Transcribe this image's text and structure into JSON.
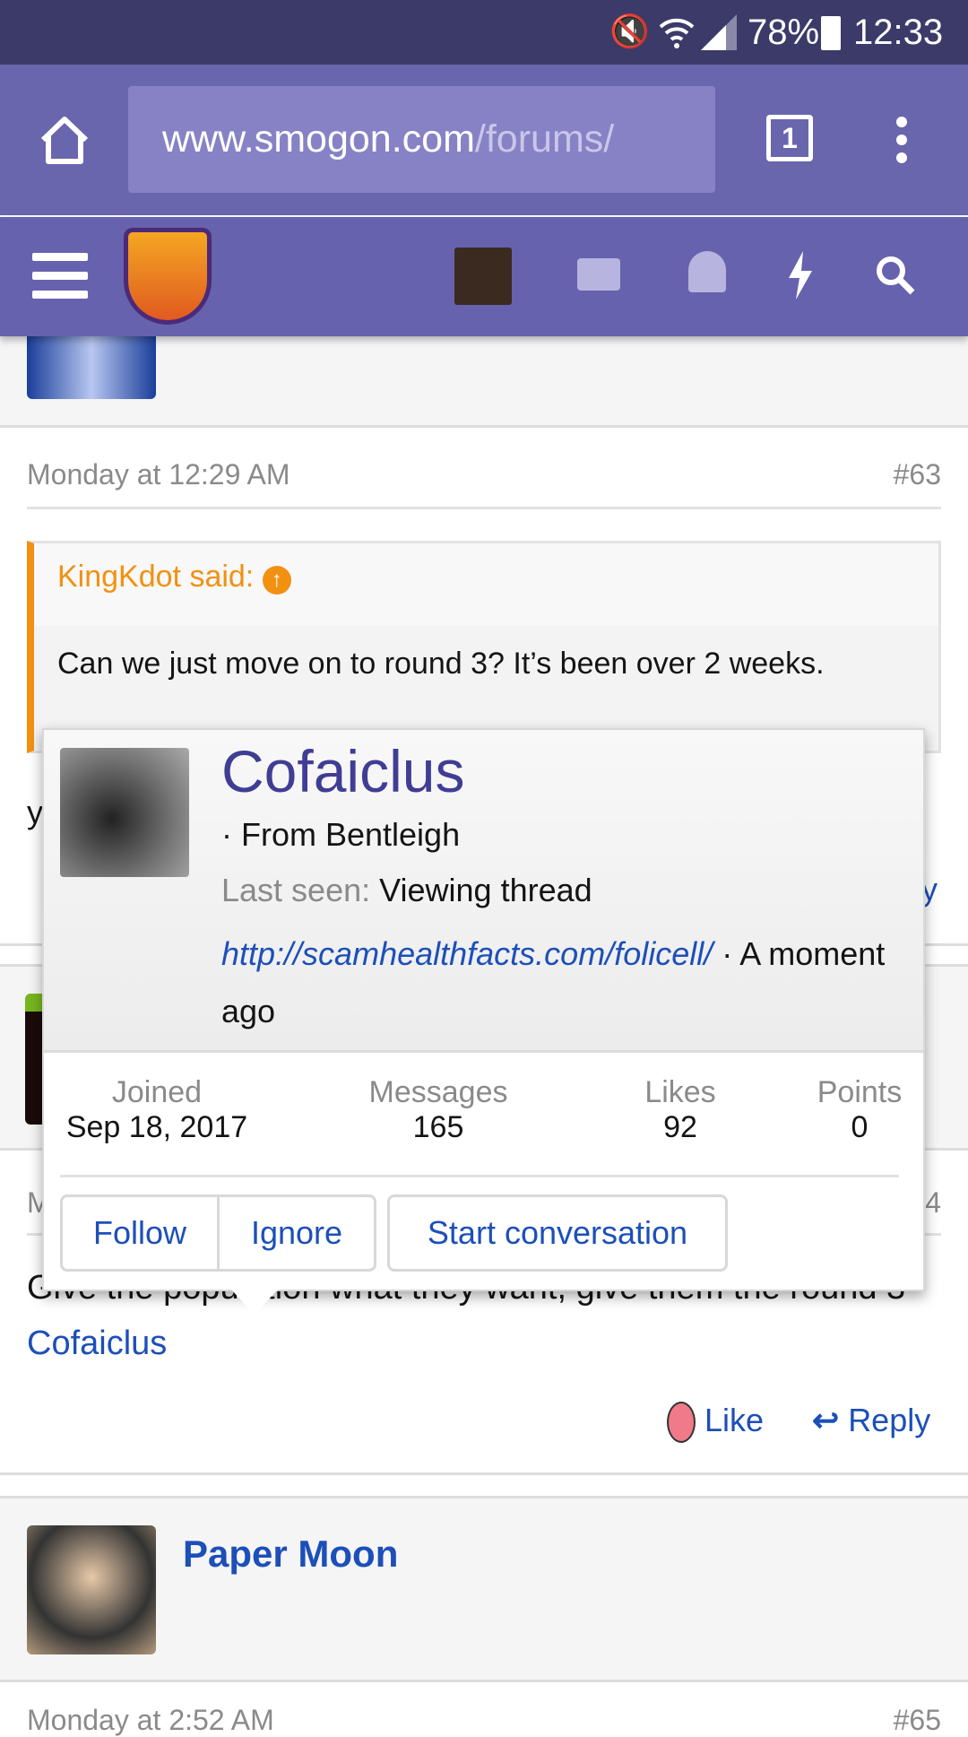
{
  "status_bar": {
    "battery": "78%",
    "time": "12:33",
    "icons": [
      "mute-icon",
      "wifi-icon",
      "signal-icon",
      "battery-icon"
    ]
  },
  "browser": {
    "url_host": "www.smogon.com",
    "url_path": "/forums/",
    "tab_count": "1",
    "icons": [
      "home-icon",
      "tabs-icon",
      "more-icon"
    ]
  },
  "forum_nav": {
    "icons": [
      "menu-icon",
      "smogon-logo",
      "user-avatar",
      "mail-icon",
      "bell-icon",
      "lightning-icon",
      "search-icon"
    ]
  },
  "post63": {
    "date": "Monday at 12:29 AM",
    "number": "#63",
    "quote_author": "KingKdot said:",
    "quote_text": "Can we just move on to round 3? It’s been over 2 weeks.",
    "body_partial": "y",
    "reply_partial": "y"
  },
  "post64": {
    "date_partial": "M",
    "number_partial": "4",
    "body": "Give the population what they want, give them the round 3 ",
    "mention": "Cofaiclus",
    "like": "Like",
    "reply": "Reply"
  },
  "post65": {
    "author": "Paper Moon",
    "date": "Monday at 2:52 AM",
    "number": "#65"
  },
  "popup": {
    "name": "Cofaiclus",
    "location": "· From Bentleigh",
    "last_seen_label": "Last seen:",
    "last_seen_value": "Viewing thread",
    "link": "http://scamhealthfacts.com/folicell/",
    "time_suffix": " · A moment ago",
    "stats": [
      {
        "label": "Joined",
        "value": "Sep 18, 2017"
      },
      {
        "label": "Messages",
        "value": "165"
      },
      {
        "label": "Likes",
        "value": "92"
      },
      {
        "label": "Points",
        "value": "0"
      }
    ],
    "buttons": {
      "follow": "Follow",
      "ignore": "Ignore",
      "start_conversation": "Start conversation"
    }
  },
  "colors": {
    "nav": "#6762ad",
    "status": "#3b3a68",
    "quote_accent": "#f29111",
    "link": "#1d4fb8",
    "popup_name": "#3f3d94"
  }
}
